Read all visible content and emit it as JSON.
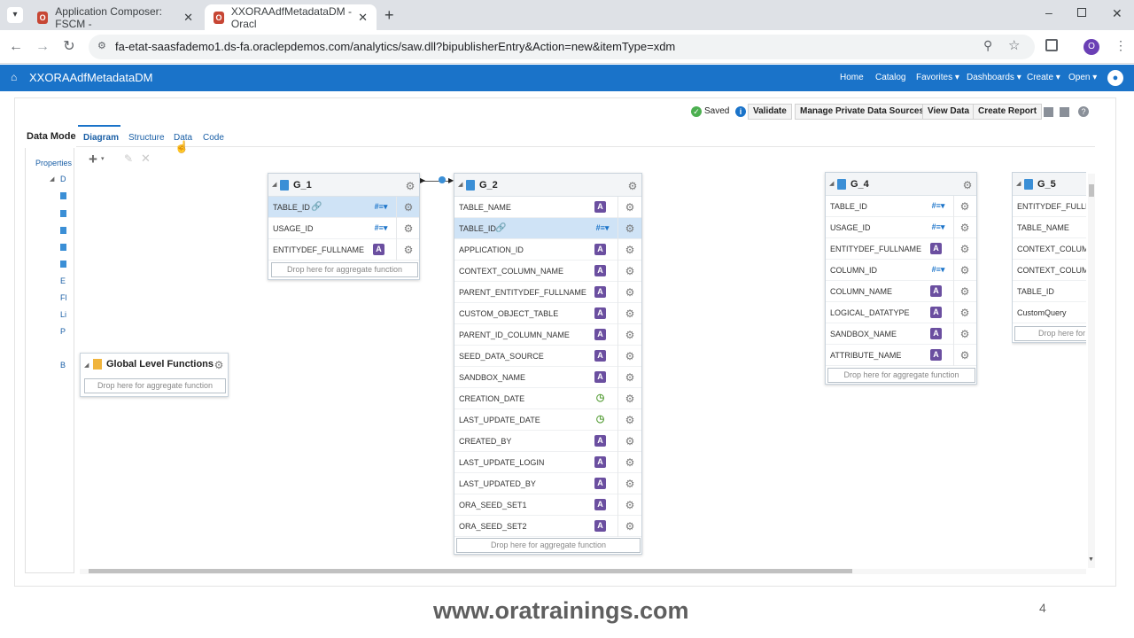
{
  "browser": {
    "tabs": [
      {
        "label": "Application Composer: FSCM -"
      },
      {
        "label": "XXORAAdfMetadataDM - Oracl"
      }
    ],
    "url": "fa-etat-saasfademo1.ds-fa.oraclepdemos.com/analytics/saw.dll?bipublisherEntry&Action=new&itemType=xdm",
    "profile_initial": "O"
  },
  "header": {
    "title": "XXORAAdfMetadataDM",
    "nav": [
      "Home",
      "Catalog",
      "Favorites ▾",
      "Dashboards ▾",
      "Create ▾",
      "Open ▾"
    ]
  },
  "toolbar": {
    "saved_label": "Saved",
    "validate_label": "Validate",
    "manage_label": "Manage Private Data Sources",
    "view_data_label": "View Data",
    "create_report_label": "Create Report"
  },
  "left": {
    "title": "Data Mode",
    "properties_label": "Properties",
    "tree_letters": [
      "D",
      "E",
      "Fl",
      "Li",
      "P",
      "B"
    ]
  },
  "subtabs": [
    "Diagram",
    "Structure",
    "Data",
    "Code"
  ],
  "global_functions": {
    "label": "Global Level Functions",
    "drop": "Drop here for aggregate function"
  },
  "groups": {
    "g1": {
      "name": "G_1",
      "rows": [
        {
          "name": "TABLE_ID",
          "type": "#"
        },
        {
          "name": "USAGE_ID",
          "type": "#"
        },
        {
          "name": "ENTITYDEF_FULLNAME",
          "type": "A"
        }
      ],
      "drop": "Drop here for aggregate function"
    },
    "g2": {
      "name": "G_2",
      "rows": [
        {
          "name": "TABLE_NAME",
          "type": "A"
        },
        {
          "name": "TABLE_ID",
          "type": "#"
        },
        {
          "name": "APPLICATION_ID",
          "type": "A"
        },
        {
          "name": "CONTEXT_COLUMN_NAME",
          "type": "A"
        },
        {
          "name": "PARENT_ENTITYDEF_FULLNAME",
          "type": "A"
        },
        {
          "name": "CUSTOM_OBJECT_TABLE",
          "type": "A"
        },
        {
          "name": "PARENT_ID_COLUMN_NAME",
          "type": "A"
        },
        {
          "name": "SEED_DATA_SOURCE",
          "type": "A"
        },
        {
          "name": "SANDBOX_NAME",
          "type": "A"
        },
        {
          "name": "CREATION_DATE",
          "type": "D"
        },
        {
          "name": "LAST_UPDATE_DATE",
          "type": "D"
        },
        {
          "name": "CREATED_BY",
          "type": "A"
        },
        {
          "name": "LAST_UPDATE_LOGIN",
          "type": "A"
        },
        {
          "name": "LAST_UPDATED_BY",
          "type": "A"
        },
        {
          "name": "ORA_SEED_SET1",
          "type": "A"
        },
        {
          "name": "ORA_SEED_SET2",
          "type": "A"
        }
      ],
      "drop": "Drop here for aggregate function"
    },
    "g4": {
      "name": "G_4",
      "rows": [
        {
          "name": "TABLE_ID",
          "type": "#"
        },
        {
          "name": "USAGE_ID",
          "type": "#"
        },
        {
          "name": "ENTITYDEF_FULLNAME",
          "type": "A"
        },
        {
          "name": "COLUMN_ID",
          "type": "#"
        },
        {
          "name": "COLUMN_NAME",
          "type": "A"
        },
        {
          "name": "LOGICAL_DATATYPE",
          "type": "A"
        },
        {
          "name": "SANDBOX_NAME",
          "type": "A"
        },
        {
          "name": "ATTRIBUTE_NAME",
          "type": "A"
        }
      ],
      "drop": "Drop here for aggregate function"
    },
    "g5": {
      "name": "G_5",
      "rows": [
        {
          "name": "ENTITYDEF_FULLN"
        },
        {
          "name": "TABLE_NAME"
        },
        {
          "name": "CONTEXT_COLUM"
        },
        {
          "name": "CONTEXT_COLUM"
        },
        {
          "name": "TABLE_ID"
        },
        {
          "name": "CustomQuery"
        }
      ],
      "drop": "Drop here for"
    }
  },
  "footer": {
    "watermark": "www.oratrainings.com",
    "page": "4"
  },
  "colors": {
    "header_blue": "#1a73c9",
    "attr_purple": "#6b4fa0",
    "selected_row": "#cfe3f6"
  }
}
